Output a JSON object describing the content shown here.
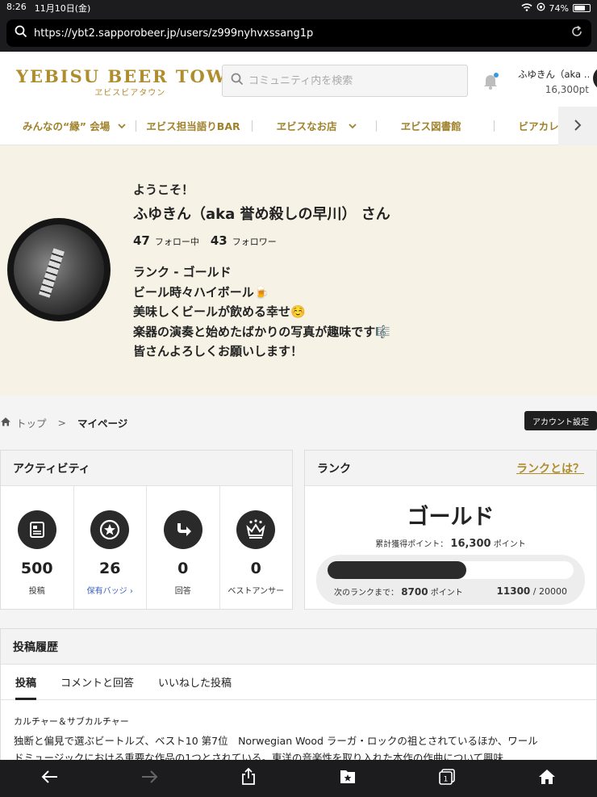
{
  "status_bar": {
    "time": "8:26",
    "date": "11月10日(金)",
    "battery": "74%",
    "battery_level": 0.74
  },
  "browser": {
    "url": "https://ybt2.sapporobeer.jp/users/z999nyhvxssang1p"
  },
  "header": {
    "logo_main": "YEBISU BEER TOWN",
    "logo_sub": "ヱビスビアタウン",
    "search_placeholder": "コミュニティ内を検索",
    "user_name": "ふゆきん（aka …",
    "user_points": "16,300pt"
  },
  "nav": {
    "items": [
      {
        "label": "みんなの“縁” 会場",
        "has_dropdown": true
      },
      {
        "label": "ヱビス担当語りBAR",
        "has_dropdown": false
      },
      {
        "label": "ヱビスなお店",
        "has_dropdown": true
      },
      {
        "label": "ヱビス図書館",
        "has_dropdown": false
      },
      {
        "label": "ビアカレ",
        "has_dropdown": false
      }
    ]
  },
  "profile": {
    "welcome": "ようこそ！",
    "name": "ふゆきん（aka 誉め殺しの早川） さん",
    "following_count": "47",
    "following_label": "フォロー中",
    "follower_count": "43",
    "follower_label": "フォロワー",
    "bio": [
      "ランク - ゴールド",
      "ビール時々ハイボール🍺",
      "美味しくビールが飲める幸せ☺️",
      "楽器の演奏と始めたばかりの写真が趣味です🎼",
      "皆さんよろしくお願いします！"
    ]
  },
  "breadcrumb": {
    "home": "トップ",
    "separator": ">",
    "current": "マイページ"
  },
  "account_button": "アカウント設定",
  "activity": {
    "title": "アクティビティ",
    "cells": [
      {
        "icon": "post-icon",
        "value": "500",
        "label": "投稿"
      },
      {
        "icon": "badge-icon",
        "value": "26",
        "label": "保有バッジ"
      },
      {
        "icon": "reply-icon",
        "value": "0",
        "label": "回答"
      },
      {
        "icon": "crown-icon",
        "value": "0",
        "label": "ベストアンサー"
      }
    ]
  },
  "rank": {
    "title": "ランク",
    "link": "ランクとは？",
    "name": "ゴールド",
    "accum_label": "累計獲得ポイント：",
    "accum_value": "16,300",
    "accum_unit": "ポイント",
    "next_label": "次のランクまで：",
    "next_value": "8700",
    "next_unit": "ポイント",
    "current": "11300",
    "slash": "/",
    "target": "20000",
    "progress_fraction": 0.565
  },
  "posts": {
    "title": "投稿履歴",
    "tabs": [
      "投稿",
      "コメントと回答",
      "いいねした投稿"
    ],
    "active_tab": 0,
    "items": [
      {
        "category": "カルチャー＆サブカルチャー",
        "text": "独断と偏見で選ぶビートルズ、ベスト10 第7位　Norwegian Wood ラーガ・ロックの祖とされているほか、ワールドミュージックにおける重要な作品の1つとされている。東洋の音楽性を取り入れた本作の作曲について興味…"
      }
    ]
  },
  "colors": {
    "gold": "#b08d2c",
    "profile_bg": "#f7f2e6",
    "dark": "#1c1c1e"
  }
}
